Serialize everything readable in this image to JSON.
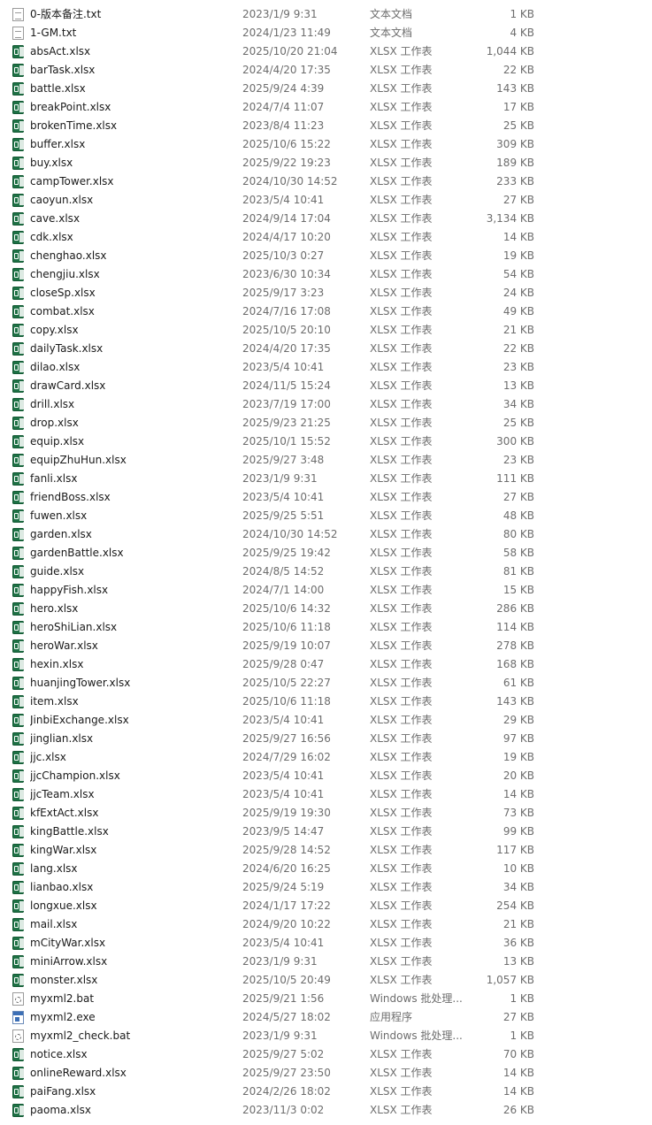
{
  "files": [
    {
      "name": "0-版本备注.txt",
      "date": "2023/1/9 9:31",
      "type": "文本文档",
      "size": "1 KB",
      "icon": "text-file-icon"
    },
    {
      "name": "1-GM.txt",
      "date": "2024/1/23 11:49",
      "type": "文本文档",
      "size": "4 KB",
      "icon": "text-file-icon"
    },
    {
      "name": "absAct.xlsx",
      "date": "2025/10/20 21:04",
      "type": "XLSX 工作表",
      "size": "1,044 KB",
      "icon": "excel-file-icon"
    },
    {
      "name": "barTask.xlsx",
      "date": "2024/4/20 17:35",
      "type": "XLSX 工作表",
      "size": "22 KB",
      "icon": "excel-file-icon"
    },
    {
      "name": "battle.xlsx",
      "date": "2025/9/24 4:39",
      "type": "XLSX 工作表",
      "size": "143 KB",
      "icon": "excel-file-icon"
    },
    {
      "name": "breakPoint.xlsx",
      "date": "2024/7/4 11:07",
      "type": "XLSX 工作表",
      "size": "17 KB",
      "icon": "excel-file-icon"
    },
    {
      "name": "brokenTime.xlsx",
      "date": "2023/8/4 11:23",
      "type": "XLSX 工作表",
      "size": "25 KB",
      "icon": "excel-file-icon"
    },
    {
      "name": "buffer.xlsx",
      "date": "2025/10/6 15:22",
      "type": "XLSX 工作表",
      "size": "309 KB",
      "icon": "excel-file-icon"
    },
    {
      "name": "buy.xlsx",
      "date": "2025/9/22 19:23",
      "type": "XLSX 工作表",
      "size": "189 KB",
      "icon": "excel-file-icon"
    },
    {
      "name": "campTower.xlsx",
      "date": "2024/10/30 14:52",
      "type": "XLSX 工作表",
      "size": "233 KB",
      "icon": "excel-file-icon"
    },
    {
      "name": "caoyun.xlsx",
      "date": "2023/5/4 10:41",
      "type": "XLSX 工作表",
      "size": "27 KB",
      "icon": "excel-file-icon"
    },
    {
      "name": "cave.xlsx",
      "date": "2024/9/14 17:04",
      "type": "XLSX 工作表",
      "size": "3,134 KB",
      "icon": "excel-file-icon"
    },
    {
      "name": "cdk.xlsx",
      "date": "2024/4/17 10:20",
      "type": "XLSX 工作表",
      "size": "14 KB",
      "icon": "excel-file-icon"
    },
    {
      "name": "chenghao.xlsx",
      "date": "2025/10/3 0:27",
      "type": "XLSX 工作表",
      "size": "19 KB",
      "icon": "excel-file-icon"
    },
    {
      "name": "chengjiu.xlsx",
      "date": "2023/6/30 10:34",
      "type": "XLSX 工作表",
      "size": "54 KB",
      "icon": "excel-file-icon"
    },
    {
      "name": "closeSp.xlsx",
      "date": "2025/9/17 3:23",
      "type": "XLSX 工作表",
      "size": "24 KB",
      "icon": "excel-file-icon"
    },
    {
      "name": "combat.xlsx",
      "date": "2024/7/16 17:08",
      "type": "XLSX 工作表",
      "size": "49 KB",
      "icon": "excel-file-icon"
    },
    {
      "name": "copy.xlsx",
      "date": "2025/10/5 20:10",
      "type": "XLSX 工作表",
      "size": "21 KB",
      "icon": "excel-file-icon"
    },
    {
      "name": "dailyTask.xlsx",
      "date": "2024/4/20 17:35",
      "type": "XLSX 工作表",
      "size": "22 KB",
      "icon": "excel-file-icon"
    },
    {
      "name": "dilao.xlsx",
      "date": "2023/5/4 10:41",
      "type": "XLSX 工作表",
      "size": "23 KB",
      "icon": "excel-file-icon"
    },
    {
      "name": "drawCard.xlsx",
      "date": "2024/11/5 15:24",
      "type": "XLSX 工作表",
      "size": "13 KB",
      "icon": "excel-file-icon"
    },
    {
      "name": "drill.xlsx",
      "date": "2023/7/19 17:00",
      "type": "XLSX 工作表",
      "size": "34 KB",
      "icon": "excel-file-icon"
    },
    {
      "name": "drop.xlsx",
      "date": "2025/9/23 21:25",
      "type": "XLSX 工作表",
      "size": "25 KB",
      "icon": "excel-file-icon"
    },
    {
      "name": "equip.xlsx",
      "date": "2025/10/1 15:52",
      "type": "XLSX 工作表",
      "size": "300 KB",
      "icon": "excel-file-icon"
    },
    {
      "name": "equipZhuHun.xlsx",
      "date": "2025/9/27 3:48",
      "type": "XLSX 工作表",
      "size": "23 KB",
      "icon": "excel-file-icon"
    },
    {
      "name": "fanli.xlsx",
      "date": "2023/1/9 9:31",
      "type": "XLSX 工作表",
      "size": "111 KB",
      "icon": "excel-file-icon"
    },
    {
      "name": "friendBoss.xlsx",
      "date": "2023/5/4 10:41",
      "type": "XLSX 工作表",
      "size": "27 KB",
      "icon": "excel-file-icon"
    },
    {
      "name": "fuwen.xlsx",
      "date": "2025/9/25 5:51",
      "type": "XLSX 工作表",
      "size": "48 KB",
      "icon": "excel-file-icon"
    },
    {
      "name": "garden.xlsx",
      "date": "2024/10/30 14:52",
      "type": "XLSX 工作表",
      "size": "80 KB",
      "icon": "excel-file-icon"
    },
    {
      "name": "gardenBattle.xlsx",
      "date": "2025/9/25 19:42",
      "type": "XLSX 工作表",
      "size": "58 KB",
      "icon": "excel-file-icon"
    },
    {
      "name": "guide.xlsx",
      "date": "2024/8/5 14:52",
      "type": "XLSX 工作表",
      "size": "81 KB",
      "icon": "excel-file-icon"
    },
    {
      "name": "happyFish.xlsx",
      "date": "2024/7/1 14:00",
      "type": "XLSX 工作表",
      "size": "15 KB",
      "icon": "excel-file-icon"
    },
    {
      "name": "hero.xlsx",
      "date": "2025/10/6 14:32",
      "type": "XLSX 工作表",
      "size": "286 KB",
      "icon": "excel-file-icon"
    },
    {
      "name": "heroShiLian.xlsx",
      "date": "2025/10/6 11:18",
      "type": "XLSX 工作表",
      "size": "114 KB",
      "icon": "excel-file-icon"
    },
    {
      "name": "heroWar.xlsx",
      "date": "2025/9/19 10:07",
      "type": "XLSX 工作表",
      "size": "278 KB",
      "icon": "excel-file-icon"
    },
    {
      "name": "hexin.xlsx",
      "date": "2025/9/28 0:47",
      "type": "XLSX 工作表",
      "size": "168 KB",
      "icon": "excel-file-icon"
    },
    {
      "name": "huanjingTower.xlsx",
      "date": "2025/10/5 22:27",
      "type": "XLSX 工作表",
      "size": "61 KB",
      "icon": "excel-file-icon"
    },
    {
      "name": "item.xlsx",
      "date": "2025/10/6 11:18",
      "type": "XLSX 工作表",
      "size": "143 KB",
      "icon": "excel-file-icon"
    },
    {
      "name": "JinbiExchange.xlsx",
      "date": "2023/5/4 10:41",
      "type": "XLSX 工作表",
      "size": "29 KB",
      "icon": "excel-file-icon"
    },
    {
      "name": "jinglian.xlsx",
      "date": "2025/9/27 16:56",
      "type": "XLSX 工作表",
      "size": "97 KB",
      "icon": "excel-file-icon"
    },
    {
      "name": "jjc.xlsx",
      "date": "2024/7/29 16:02",
      "type": "XLSX 工作表",
      "size": "19 KB",
      "icon": "excel-file-icon"
    },
    {
      "name": "jjcChampion.xlsx",
      "date": "2023/5/4 10:41",
      "type": "XLSX 工作表",
      "size": "20 KB",
      "icon": "excel-file-icon"
    },
    {
      "name": "jjcTeam.xlsx",
      "date": "2023/5/4 10:41",
      "type": "XLSX 工作表",
      "size": "14 KB",
      "icon": "excel-file-icon"
    },
    {
      "name": "kfExtAct.xlsx",
      "date": "2025/9/19 19:30",
      "type": "XLSX 工作表",
      "size": "73 KB",
      "icon": "excel-file-icon"
    },
    {
      "name": "kingBattle.xlsx",
      "date": "2023/9/5 14:47",
      "type": "XLSX 工作表",
      "size": "99 KB",
      "icon": "excel-file-icon"
    },
    {
      "name": "kingWar.xlsx",
      "date": "2025/9/28 14:52",
      "type": "XLSX 工作表",
      "size": "117 KB",
      "icon": "excel-file-icon"
    },
    {
      "name": "lang.xlsx",
      "date": "2024/6/20 16:25",
      "type": "XLSX 工作表",
      "size": "10 KB",
      "icon": "excel-file-icon"
    },
    {
      "name": "lianbao.xlsx",
      "date": "2025/9/24 5:19",
      "type": "XLSX 工作表",
      "size": "34 KB",
      "icon": "excel-file-icon"
    },
    {
      "name": "longxue.xlsx",
      "date": "2024/1/17 17:22",
      "type": "XLSX 工作表",
      "size": "254 KB",
      "icon": "excel-file-icon"
    },
    {
      "name": "mail.xlsx",
      "date": "2024/9/20 10:22",
      "type": "XLSX 工作表",
      "size": "21 KB",
      "icon": "excel-file-icon"
    },
    {
      "name": "mCityWar.xlsx",
      "date": "2023/5/4 10:41",
      "type": "XLSX 工作表",
      "size": "36 KB",
      "icon": "excel-file-icon"
    },
    {
      "name": "miniArrow.xlsx",
      "date": "2023/1/9 9:31",
      "type": "XLSX 工作表",
      "size": "13 KB",
      "icon": "excel-file-icon"
    },
    {
      "name": "monster.xlsx",
      "date": "2025/10/5 20:49",
      "type": "XLSX 工作表",
      "size": "1,057 KB",
      "icon": "excel-file-icon"
    },
    {
      "name": "myxml2.bat",
      "date": "2025/9/21 1:56",
      "type": "Windows 批处理...",
      "size": "1 KB",
      "icon": "batch-file-icon"
    },
    {
      "name": "myxml2.exe",
      "date": "2024/5/27 18:02",
      "type": "应用程序",
      "size": "27 KB",
      "icon": "application-icon"
    },
    {
      "name": "myxml2_check.bat",
      "date": "2023/1/9 9:31",
      "type": "Windows 批处理...",
      "size": "1 KB",
      "icon": "batch-file-icon"
    },
    {
      "name": "notice.xlsx",
      "date": "2025/9/27 5:02",
      "type": "XLSX 工作表",
      "size": "70 KB",
      "icon": "excel-file-icon"
    },
    {
      "name": "onlineReward.xlsx",
      "date": "2025/9/27 23:50",
      "type": "XLSX 工作表",
      "size": "14 KB",
      "icon": "excel-file-icon"
    },
    {
      "name": "paiFang.xlsx",
      "date": "2024/2/26 18:02",
      "type": "XLSX 工作表",
      "size": "14 KB",
      "icon": "excel-file-icon"
    },
    {
      "name": "paoma.xlsx",
      "date": "2023/11/3 0:02",
      "type": "XLSX 工作表",
      "size": "26 KB",
      "icon": "excel-file-icon"
    }
  ]
}
